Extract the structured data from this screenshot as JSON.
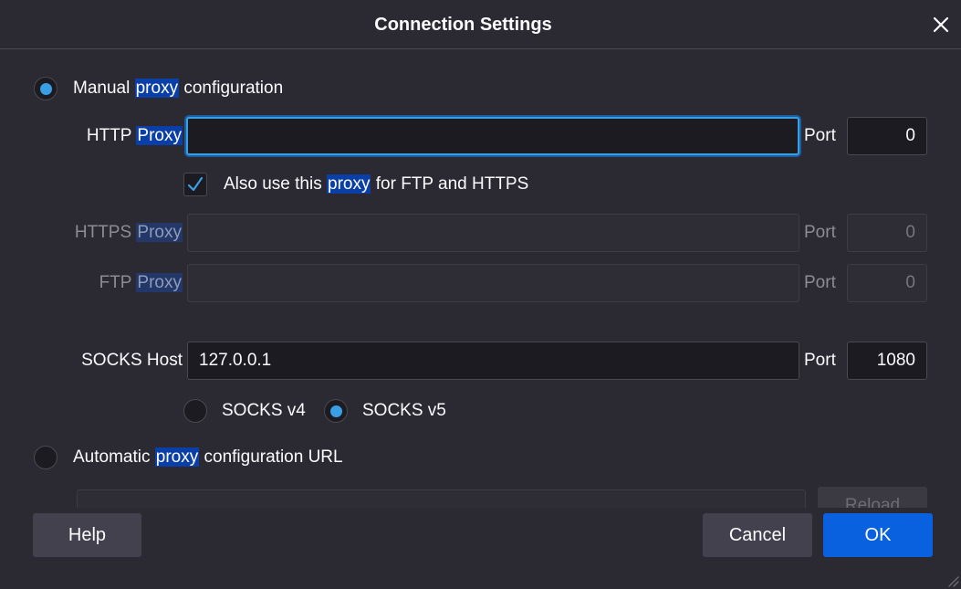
{
  "dialog": {
    "title": "Connection Settings"
  },
  "manual": {
    "label_pre": "Manual ",
    "label_hl": "proxy",
    "label_post": " configuration",
    "selected": true
  },
  "http": {
    "label_pre": "HTTP ",
    "label_hl": "Proxy",
    "value": "",
    "port_label": "Port",
    "port": "0"
  },
  "also_use": {
    "label_pre": "Also use this ",
    "label_hl": "proxy",
    "label_post": " for FTP and HTTPS",
    "checked": true
  },
  "https": {
    "label_pre": "HTTPS ",
    "label_hl": "Proxy",
    "value": "",
    "port_label": "Port",
    "port": "0"
  },
  "ftp": {
    "label_pre": "FTP ",
    "label_hl": "Proxy",
    "value": "",
    "port_label": "Port",
    "port": "0"
  },
  "socks": {
    "label": "SOCKS Host",
    "value": "127.0.0.1",
    "port_label": "Port",
    "port": "1080",
    "v4_label": "SOCKS v4",
    "v5_label": "SOCKS v5",
    "selected_version": "v5"
  },
  "auto": {
    "label_pre": "Automatic ",
    "label_hl": "proxy",
    "label_post": " configuration URL",
    "url": "",
    "reload_label": "Reload",
    "selected": false
  },
  "footer": {
    "help_label": "Help",
    "cancel_label": "Cancel",
    "ok_label": "OK"
  },
  "colors": {
    "background": "#2b2a33",
    "accent": "#0a61df",
    "radio_dot": "#3a9ee4",
    "highlight": "#0b3fa8"
  },
  "icons": {
    "close": "close-icon",
    "check": "checkmark-icon",
    "resize": "resize-grip-icon"
  }
}
